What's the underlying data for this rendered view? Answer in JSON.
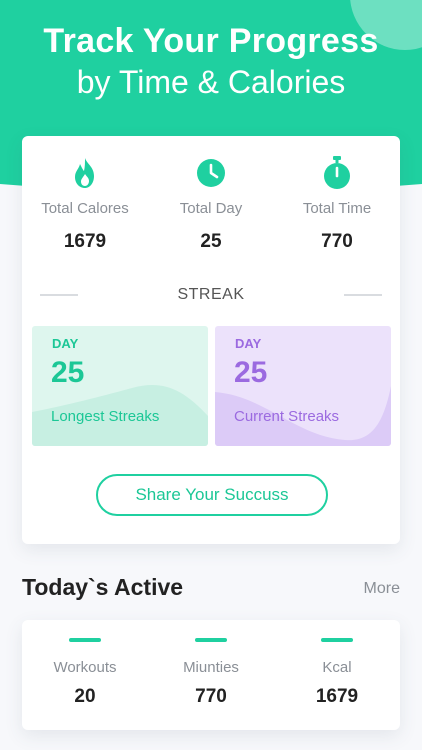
{
  "colors": {
    "accent": "#1fd0a0",
    "purple": "#9b6ae0"
  },
  "header": {
    "title": "Track Your Progress",
    "subtitle": "by Time & Calories"
  },
  "stats": [
    {
      "icon": "flame-icon",
      "label": "Total Calores",
      "value": "1679"
    },
    {
      "icon": "clock-icon",
      "label": "Total Day",
      "value": "25"
    },
    {
      "icon": "stopwatch-icon",
      "label": "Total Time",
      "value": "770"
    }
  ],
  "streak": {
    "heading": "STREAK",
    "longest": {
      "day_label": "DAY",
      "value": "25",
      "caption": "Longest Streaks"
    },
    "current": {
      "day_label": "DAY",
      "value": "25",
      "caption": "Current Streaks"
    }
  },
  "share_button": "Share Your Succuss",
  "today": {
    "title": "Today`s Active",
    "more": "More",
    "items": [
      {
        "label": "Workouts",
        "value": "20"
      },
      {
        "label": "Miunties",
        "value": "770"
      },
      {
        "label": "Kcal",
        "value": "1679"
      }
    ]
  }
}
